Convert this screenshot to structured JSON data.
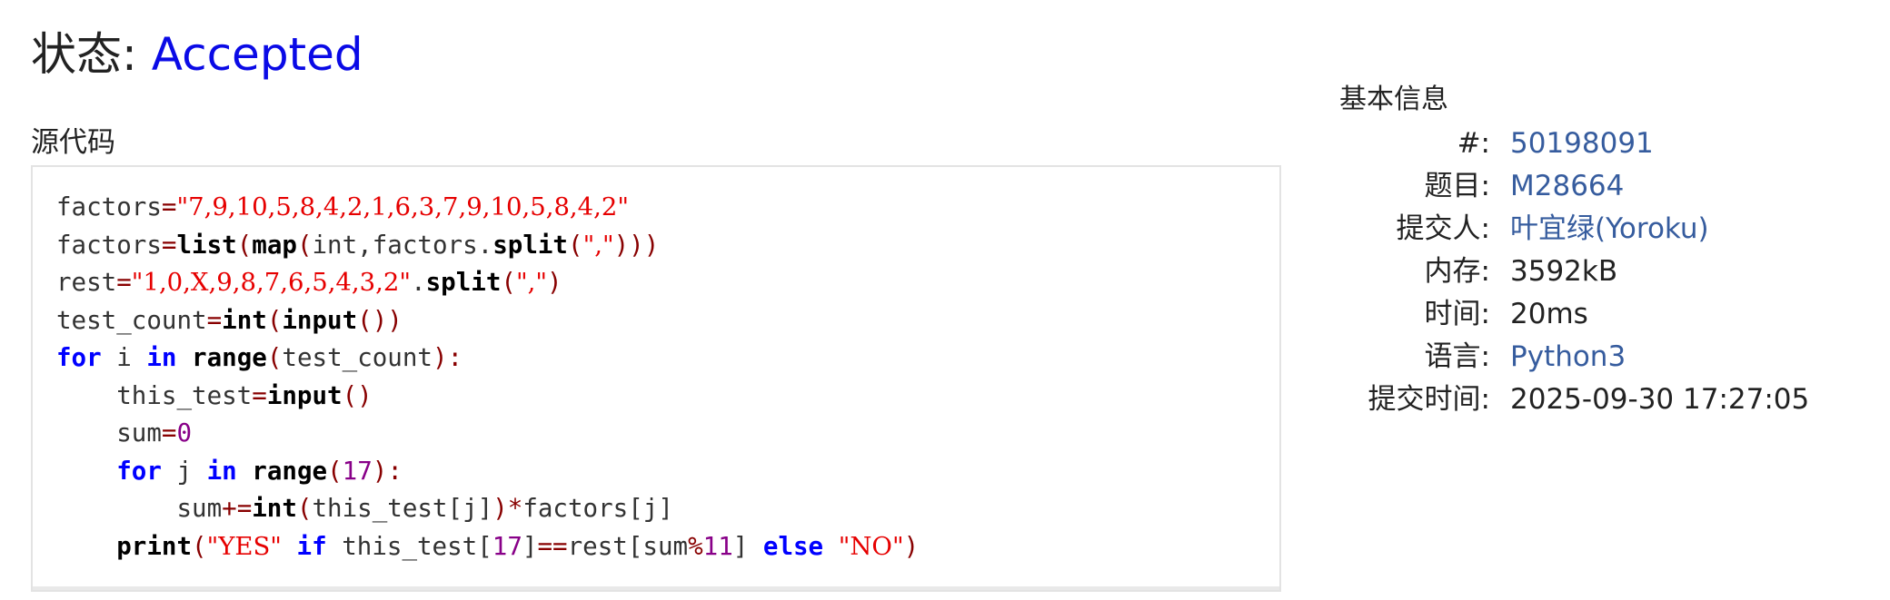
{
  "status": {
    "label": "状态: ",
    "value": "Accepted"
  },
  "source_label": "源代码",
  "code_lines": [
    "factors=\"7,9,10,5,8,4,2,1,6,3,7,9,10,5,8,4,2\"",
    "factors=list(map(int,factors.split(\",\")))",
    "rest=\"1,0,X,9,8,7,6,5,4,3,2\".split(\",\")",
    "test_count=int(input())",
    "for i in range(test_count):",
    "    this_test=input()",
    "    sum=0",
    "    for j in range(17):",
    "        sum+=int(this_test[j])*factors[j]",
    "    print(\"YES\" if this_test[17]==rest[sum%11] else \"NO\")"
  ],
  "info": {
    "title": "基本信息",
    "rows": [
      {
        "key": "#:",
        "value": "50198091"
      },
      {
        "key": "题目:",
        "value": "M28664"
      },
      {
        "key": "提交人:",
        "value": "叶宜绿(Yoroku)"
      },
      {
        "key": "内存:",
        "value": "3592kB"
      },
      {
        "key": "时间:",
        "value": "20ms"
      },
      {
        "key": "语言:",
        "value": "Python3"
      },
      {
        "key": "提交时间:",
        "value": "2025-09-30 17:27:05"
      }
    ]
  },
  "colors": {
    "accepted": "#0a0ae6",
    "link": "#365c9e",
    "keyword": "#0000ff",
    "string": "#e60000",
    "number": "#880088"
  }
}
